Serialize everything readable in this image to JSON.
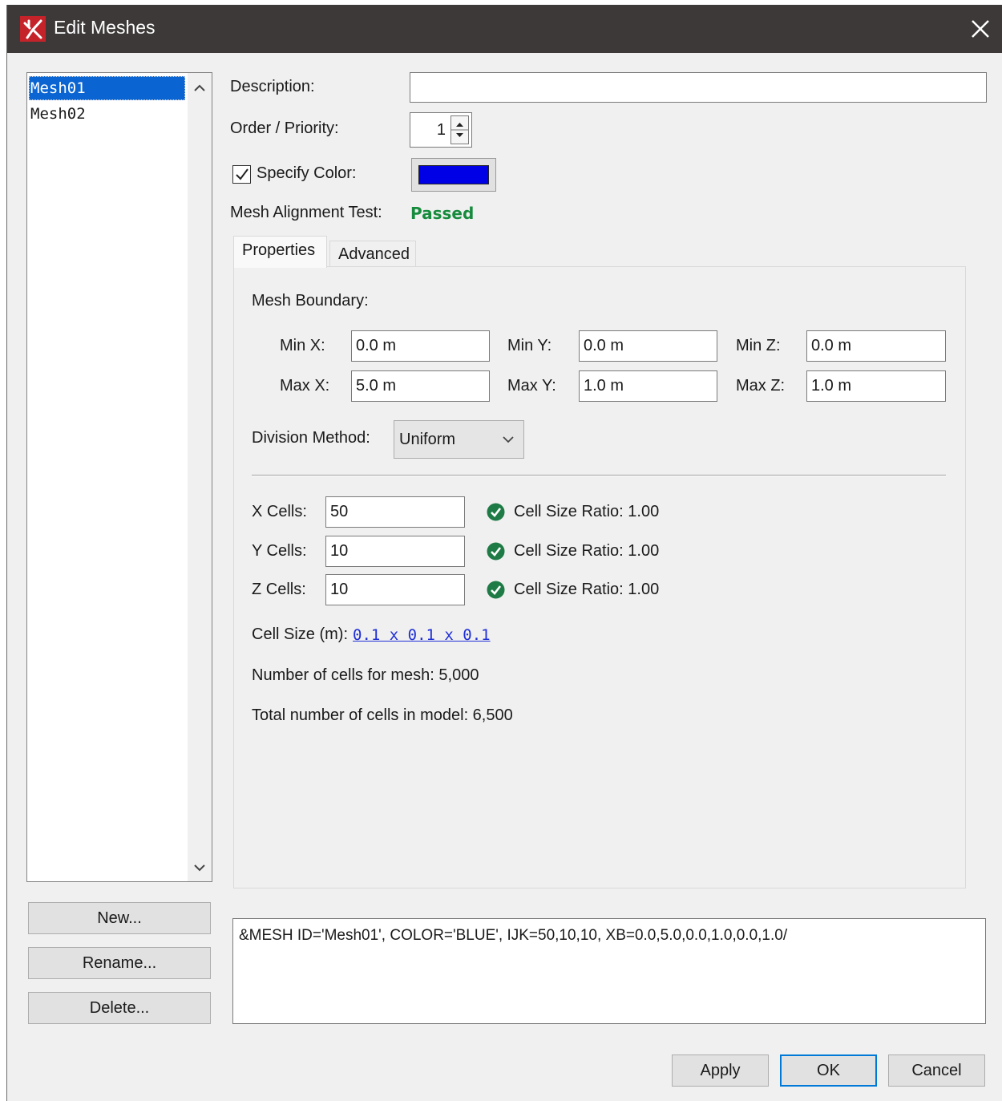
{
  "window": {
    "title": "Edit Meshes"
  },
  "mesh_list": {
    "items": [
      {
        "label": "Mesh01",
        "selected": true
      },
      {
        "label": "Mesh02",
        "selected": false
      }
    ]
  },
  "list_buttons": {
    "new": "New...",
    "rename": "Rename...",
    "delete": "Delete..."
  },
  "form": {
    "description_label": "Description:",
    "description_value": "",
    "order_label": "Order / Priority:",
    "order_value": "1",
    "specify_color_label": "Specify Color:",
    "specify_color_checked": true,
    "color_value": "#0000e6",
    "alignment_label": "Mesh Alignment Test:",
    "alignment_value": "Passed"
  },
  "tabs": [
    {
      "label": "Properties",
      "active": true
    },
    {
      "label": "Advanced",
      "active": false
    }
  ],
  "properties": {
    "boundary_label": "Mesh Boundary:",
    "min_x_label": "Min X:",
    "min_x": "0.0 m",
    "min_y_label": "Min Y:",
    "min_y": "0.0 m",
    "min_z_label": "Min Z:",
    "min_z": "0.0 m",
    "max_x_label": "Max X:",
    "max_x": "5.0 m",
    "max_y_label": "Max Y:",
    "max_y": "1.0 m",
    "max_z_label": "Max Z:",
    "max_z": "1.0 m",
    "division_label": "Division Method:",
    "division_value": "Uniform",
    "x_cells_label": "X Cells:",
    "x_cells": "50",
    "x_ratio": "Cell Size Ratio: 1.00",
    "y_cells_label": "Y Cells:",
    "y_cells": "10",
    "y_ratio": "Cell Size Ratio: 1.00",
    "z_cells_label": "Z Cells:",
    "z_cells": "10",
    "z_ratio": "Cell Size Ratio: 1.00",
    "cell_size_label": "Cell Size (m):",
    "cell_size_value": "0.1 x 0.1 x 0.1",
    "mesh_cells_text": "Number of cells for mesh: 5,000",
    "total_cells_text": "Total number of cells in model: 6,500"
  },
  "output": {
    "text": "&MESH ID='Mesh01', COLOR='BLUE', IJK=50,10,10, XB=0.0,5.0,0.0,1.0,0.0,1.0/"
  },
  "dialog_buttons": {
    "apply": "Apply",
    "ok": "OK",
    "cancel": "Cancel"
  },
  "colors": {
    "title_bar": "#3d3938",
    "selection": "#0a64d2",
    "passed": "#178b3d",
    "ok_check": "#1e7b45",
    "link": "#1f2fd6"
  }
}
